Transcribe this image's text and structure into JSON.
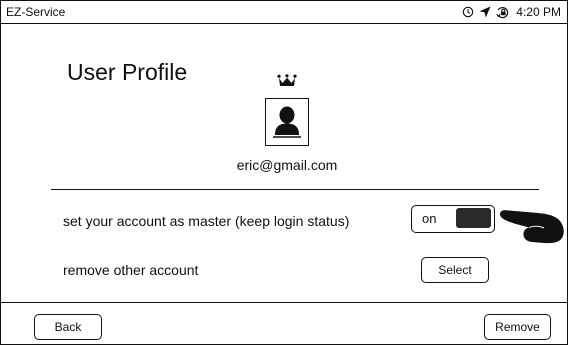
{
  "status_bar": {
    "app_name": "EZ-Service",
    "time": "4:20 PM",
    "icons": [
      "alarm-icon",
      "location-arrow-icon",
      "rotation-lock-icon"
    ]
  },
  "profile": {
    "title": "User Profile",
    "badge_icon": "crown-icon",
    "avatar_icon": "user-silhouette-icon",
    "email": "eric@gmail.com"
  },
  "settings": {
    "master_label": "set your account as master (keep login status)",
    "master_toggle_label": "on",
    "master_toggle_state": "on",
    "pointer_icon": "hand-pointer-icon",
    "remove_label": "remove other account",
    "select_button": "Select"
  },
  "footer": {
    "back_button": "Back",
    "remove_button": "Remove"
  },
  "colors": {
    "foreground": "#111111",
    "background": "#ffffff",
    "toggle_knob": "#2a2a2a"
  }
}
